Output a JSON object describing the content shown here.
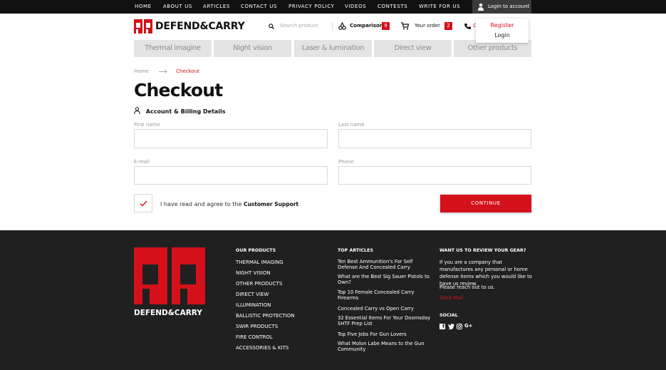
{
  "topnav": [
    "HOME",
    "ABOUT US",
    "ARTICLES",
    "CONTACT US",
    "PRIVACY POLICY",
    "VIDEOS",
    "CONTESTS",
    "WRITE FOR US"
  ],
  "account": {
    "label": "Login to account",
    "register": "Register",
    "login": "Login"
  },
  "brand": {
    "name": "DEFEND&CARRY",
    "red": "#d4111b"
  },
  "search": {
    "placeholder": "Search product"
  },
  "header": {
    "comparison_label": "Comparison",
    "comparison_count": "9",
    "order_label": "Your order",
    "order_count": "2",
    "phone_partial": "C"
  },
  "categories": [
    "Thermal imagine",
    "Night vision",
    "Laser & lumination",
    "Direct view",
    "Other products"
  ],
  "breadcrumb": {
    "home": "Home",
    "current": "Checkout"
  },
  "page_title": "Checkout",
  "section": {
    "billing": "Account & Billing Details"
  },
  "form": {
    "first_name": "First name",
    "last_name": "Last name",
    "email": "E-mail",
    "phone": "Phone"
  },
  "agree": {
    "text": "I have read and agree to the ",
    "link": "Customer Support"
  },
  "continue_label": "CONTINUE",
  "footer": {
    "products_title": "OUR PRODUCTS",
    "products": [
      "THERMAL IMAGING",
      "NIGHT VISION",
      "OTHER PRODUCTS",
      "DIRECT VIEW",
      "ILLUMINATION",
      "BALLISTIC PROTECTION",
      "SWIR PRODUCTS",
      "FIRE CONTROL",
      "ACCESSORIES & KITS"
    ],
    "articles_title": "TOP ARTICLES",
    "articles": [
      "Ten Best Ammunition's For Self Defense And Concealed Carry",
      "What are the Best Sig Sauer Pistols to Own?",
      "Top 10 Female Concealed Carry Firearms",
      "Concealed Carry vs Open Carry",
      "32 Essential Items For Your Doomsday SHTF Prep List",
      "Top Five Jobs For Gun Lovers",
      "What Molon Labe Means to the Gun Community"
    ],
    "review_title": "WANT US TO REVIEW YOUR GEAR?",
    "review_text": "If you are a company that manufactures any personal or home defense items which you would like to have us review.",
    "reach_text": "Please reach out to us.",
    "send_mail": "Send Mail",
    "social_title": "SOCIAL"
  }
}
